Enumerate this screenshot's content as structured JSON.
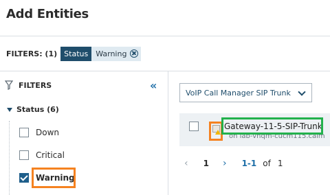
{
  "page": {
    "title": "Add Entities"
  },
  "filters_bar": {
    "label": "FILTERS: (1)",
    "chip_key": "Status",
    "chip_value": "Warning"
  },
  "left_panel": {
    "header": "FILTERS",
    "collapse_glyph": "«",
    "group": {
      "label": "Status (6)",
      "options": [
        {
          "label": "Down",
          "checked": false
        },
        {
          "label": "Critical",
          "checked": false
        },
        {
          "label": "Warning",
          "checked": true
        }
      ]
    }
  },
  "main": {
    "type_select": {
      "value": "VoIP Call Manager SIP Trunk"
    },
    "entity": {
      "name": "Gateway-11-5-SIP-Trunk",
      "sub": "on lab-vnqm-cucm115.calm"
    },
    "pager": {
      "prev": "‹",
      "page": "1",
      "next": "›",
      "range": "1-1",
      "of": "of",
      "total": "1"
    }
  },
  "colors": {
    "highlight_orange": "#f58220",
    "highlight_green": "#22b14c",
    "accent": "#1f4d6b"
  }
}
